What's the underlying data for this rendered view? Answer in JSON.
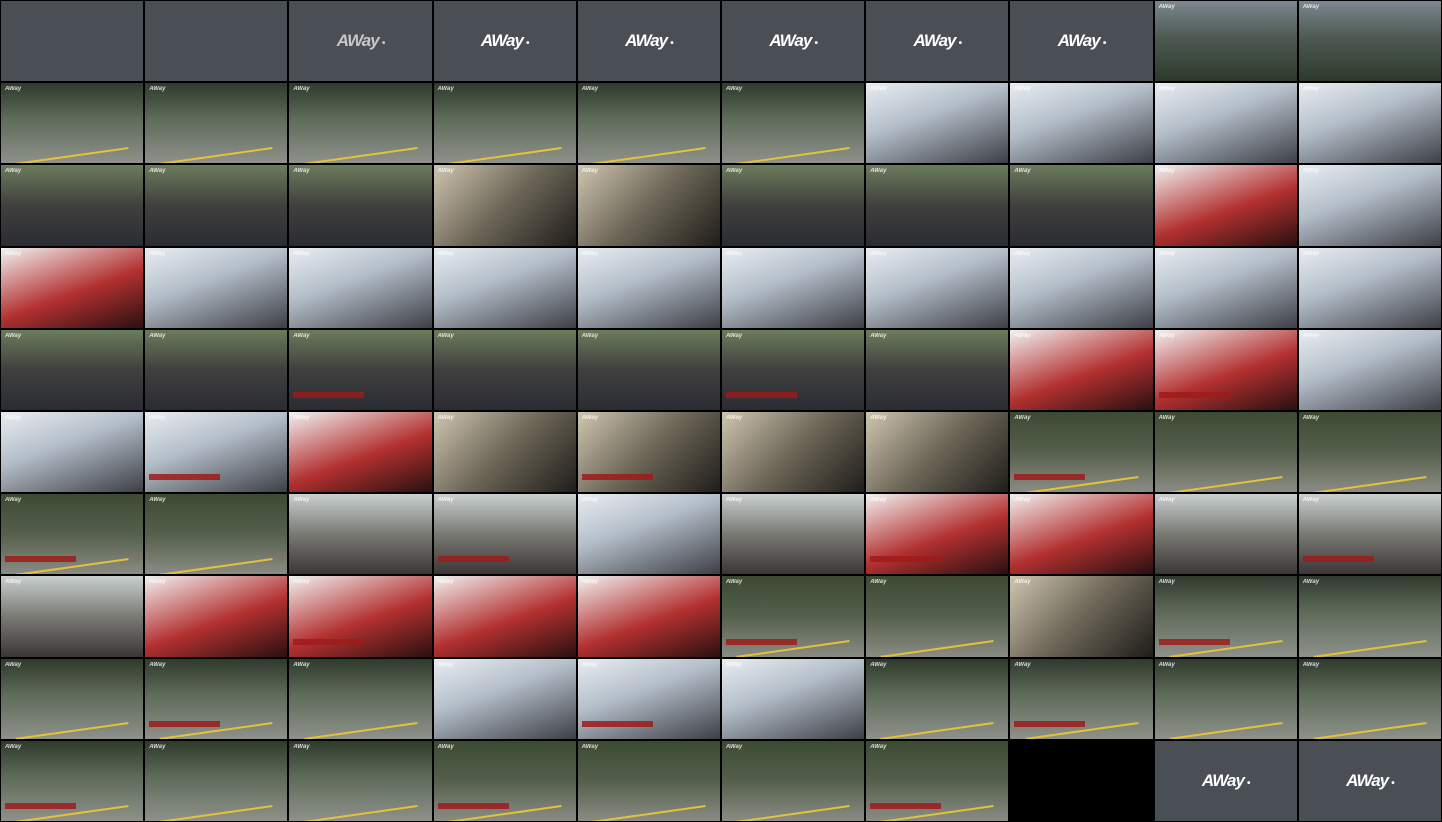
{
  "sheet": {
    "columns": 10,
    "rows": 10,
    "logo_text": "AWay"
  },
  "tiles": [
    "blank",
    "blank",
    "logo",
    "logo",
    "logo",
    "logo",
    "logo",
    "logo",
    "scene-mtn",
    "scene-mtn",
    "scene-road",
    "scene-road",
    "scene-road",
    "scene-road",
    "scene-road",
    "scene-road",
    "scene-bike",
    "scene-bike",
    "scene-bike",
    "scene-bike",
    "scene-people",
    "scene-people",
    "scene-people",
    "scene-metal",
    "scene-metal",
    "scene-people",
    "scene-people",
    "scene-people",
    "scene-red",
    "scene-bike",
    "scene-red",
    "scene-bike",
    "scene-bike",
    "scene-bike",
    "scene-bike",
    "scene-bike",
    "scene-bike",
    "scene-bike",
    "scene-bike",
    "scene-bike",
    "scene-people",
    "scene-people",
    "scene-people",
    "scene-people",
    "scene-people",
    "scene-people",
    "scene-people",
    "scene-red",
    "scene-red",
    "scene-bike",
    "scene-bike",
    "scene-bike",
    "scene-red",
    "scene-metal",
    "scene-metal",
    "scene-metal",
    "scene-metal",
    "scene-forest",
    "scene-forest",
    "scene-forest",
    "scene-forest",
    "scene-forest",
    "scene-girl",
    "scene-girl",
    "scene-bike",
    "scene-girl",
    "scene-red",
    "scene-red",
    "scene-girl",
    "scene-girl",
    "scene-girl",
    "scene-red",
    "scene-red",
    "scene-red",
    "scene-red",
    "scene-forest",
    "scene-forest",
    "scene-metal",
    "scene-road",
    "scene-road",
    "scene-road",
    "scene-road",
    "scene-road",
    "scene-bike",
    "scene-bike",
    "scene-bike",
    "scene-road",
    "scene-road",
    "scene-road",
    "scene-road",
    "scene-road",
    "scene-road",
    "scene-road",
    "scene-forest",
    "scene-forest",
    "scene-forest",
    "scene-forest",
    "black",
    "logo",
    "logo"
  ]
}
